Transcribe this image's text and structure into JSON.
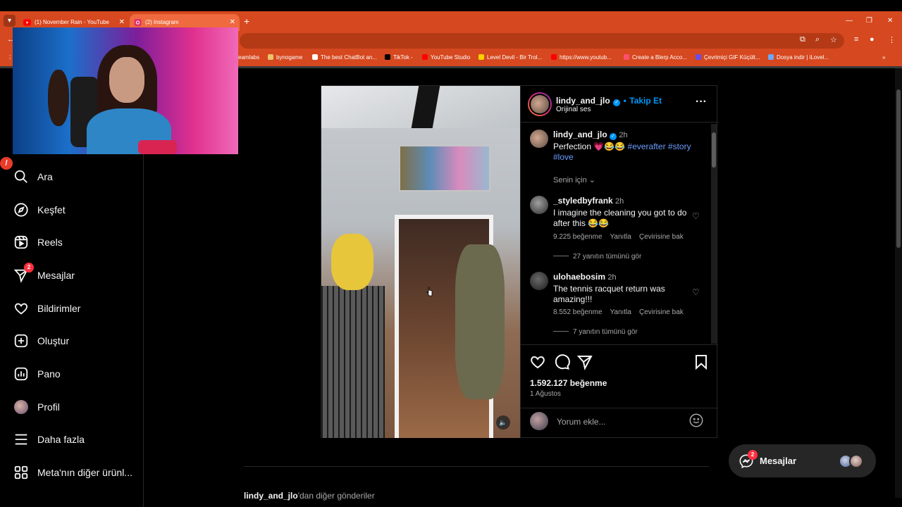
{
  "browser": {
    "tabs": [
      {
        "title": "(1) November Rain - YouTube",
        "active": false
      },
      {
        "title": "(2) Instagram",
        "active": true
      }
    ],
    "bookmarks": [
      "eamlabs",
      "bynogame",
      "The best ChatBot an...",
      "TikTok -",
      "YouTube Studio",
      "Level Devil - Bir Trol...",
      "https://www.youtub...",
      "Create a Blerp Acco...",
      "Çevrimiçi GIF Küçült...",
      "Dosya indir | iLovel..."
    ],
    "accent_color": "#d6481f"
  },
  "sidebar": {
    "items": [
      {
        "label": "Ara",
        "icon": "search-icon"
      },
      {
        "label": "Keşfet",
        "icon": "compass-icon"
      },
      {
        "label": "Reels",
        "icon": "reels-icon"
      },
      {
        "label": "Mesajlar",
        "icon": "messenger-icon",
        "badge": "2"
      },
      {
        "label": "Bildirimler",
        "icon": "heart-icon"
      },
      {
        "label": "Oluştur",
        "icon": "plus-square-icon"
      },
      {
        "label": "Pano",
        "icon": "dashboard-icon"
      },
      {
        "label": "Profil",
        "icon": "avatar"
      },
      {
        "label": "Daha fazla",
        "icon": "menu-icon"
      },
      {
        "label": "Meta'nın diğer ürünl...",
        "icon": "meta-products-icon"
      }
    ]
  },
  "post": {
    "author": "lindy_and_jlo",
    "follow_label": "Takip Et",
    "audio": "Orijinal ses",
    "caption": {
      "username": "lindy_and_jlo",
      "time": "2h",
      "text": "Perfection 💗😂😂",
      "hashtags": [
        "#everafter",
        "#story",
        "#love"
      ]
    },
    "filter_label": "Senin için",
    "comments": [
      {
        "username": "_styledbyfrank",
        "time": "2h",
        "text": "I imagine the cleaning you got to do after this 😂😂",
        "likes": "9.225 beğenme",
        "reply": "Yanıtla",
        "translate": "Çevirisine bak",
        "view_replies": "27 yanıtın tümünü gör"
      },
      {
        "username": "ulohaebosim",
        "time": "2h",
        "text": "The tennis racquet return was amazing!!!",
        "likes": "8.552 beğenme",
        "reply": "Yanıtla",
        "translate": "Çevirisine bak",
        "view_replies": "7 yanıtın tümünü gör"
      }
    ],
    "likes_count": "1.592.127 beğenme",
    "date": "1 Ağustos",
    "add_comment_placeholder": "Yorum ekle..."
  },
  "more_posts": {
    "username": "lindy_and_jlo",
    "suffix": "'dan diğer gönderiler"
  },
  "messages_pill": {
    "label": "Mesajlar",
    "badge": "2"
  }
}
